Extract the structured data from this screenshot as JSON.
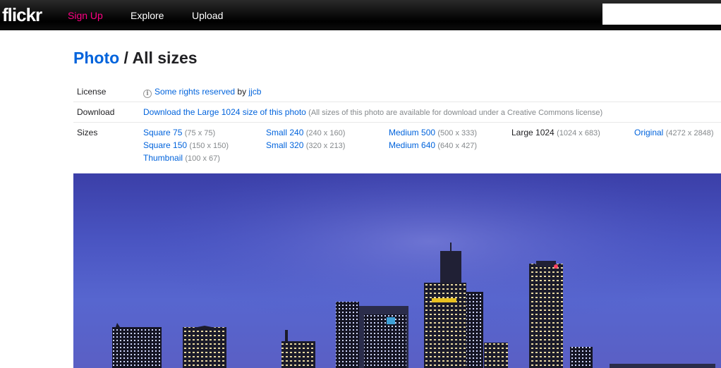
{
  "header": {
    "logo": "flickr",
    "nav": {
      "signup": "Sign Up",
      "explore": "Explore",
      "upload": "Upload"
    },
    "search": {
      "value": "",
      "placeholder": ""
    }
  },
  "page": {
    "breadcrumb": "Photo",
    "separator": "/",
    "title": "All sizes"
  },
  "license": {
    "label": "License",
    "icon": "info-icon",
    "link": "Some rights reserved",
    "by": "by",
    "author": "jjcb"
  },
  "download": {
    "label": "Download",
    "link": "Download the Large 1024 size of this photo",
    "note": "(All sizes of this photo are available for download under a Creative Commons license)"
  },
  "sizes": {
    "label": "Sizes",
    "columns": [
      [
        {
          "name": "Square 75",
          "dims": "(75 x 75)"
        },
        {
          "name": "Square 150",
          "dims": "(150 x 150)"
        },
        {
          "name": "Thumbnail",
          "dims": "(100 x 67)"
        }
      ],
      [
        {
          "name": "Small 240",
          "dims": "(240 x 160)"
        },
        {
          "name": "Small 320",
          "dims": "(320 x 213)"
        }
      ],
      [
        {
          "name": "Medium 500",
          "dims": "(500 x 333)"
        },
        {
          "name": "Medium 640",
          "dims": "(640 x 427)"
        }
      ],
      [
        {
          "name": "Large 1024",
          "dims": "(1024 x 683)",
          "current": true
        }
      ],
      [
        {
          "name": "Original",
          "dims": "(4272 x 2848)"
        }
      ]
    ]
  },
  "colors": {
    "brand_pink": "#ff0084",
    "link_blue": "#0063dc",
    "topbar": "#000000"
  }
}
